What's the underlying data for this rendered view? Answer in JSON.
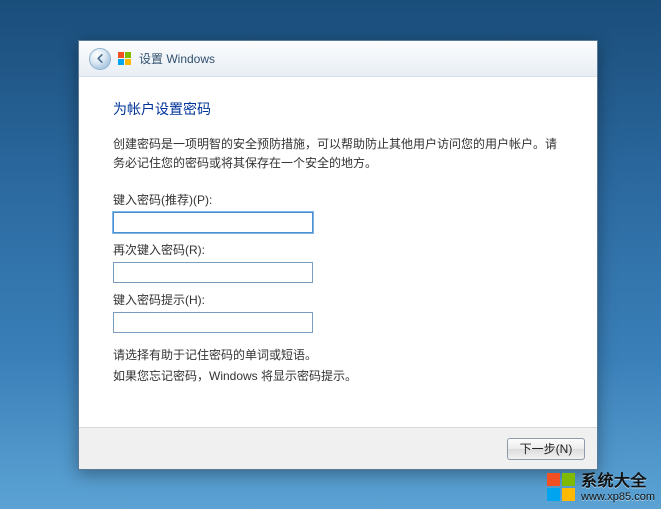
{
  "titlebar": {
    "title": "设置 Windows"
  },
  "page": {
    "heading": "为帐户设置密码",
    "description": "创建密码是一项明智的安全预防措施，可以帮助防止其他用户访问您的用户帐户。请务必记住您的密码或将其保存在一个安全的地方。",
    "password_label": "键入密码(推荐)(P):",
    "password_value": "",
    "confirm_label": "再次键入密码(R):",
    "confirm_value": "",
    "hint_label": "键入密码提示(H):",
    "hint_value": "",
    "hint_help1": "请选择有助于记住密码的单词或短语。",
    "hint_help2": "如果您忘记密码，Windows 将显示密码提示。"
  },
  "footer": {
    "next": "下一步(N)"
  },
  "watermark": {
    "brand": "系统大全",
    "url": "www.xp85.com"
  }
}
